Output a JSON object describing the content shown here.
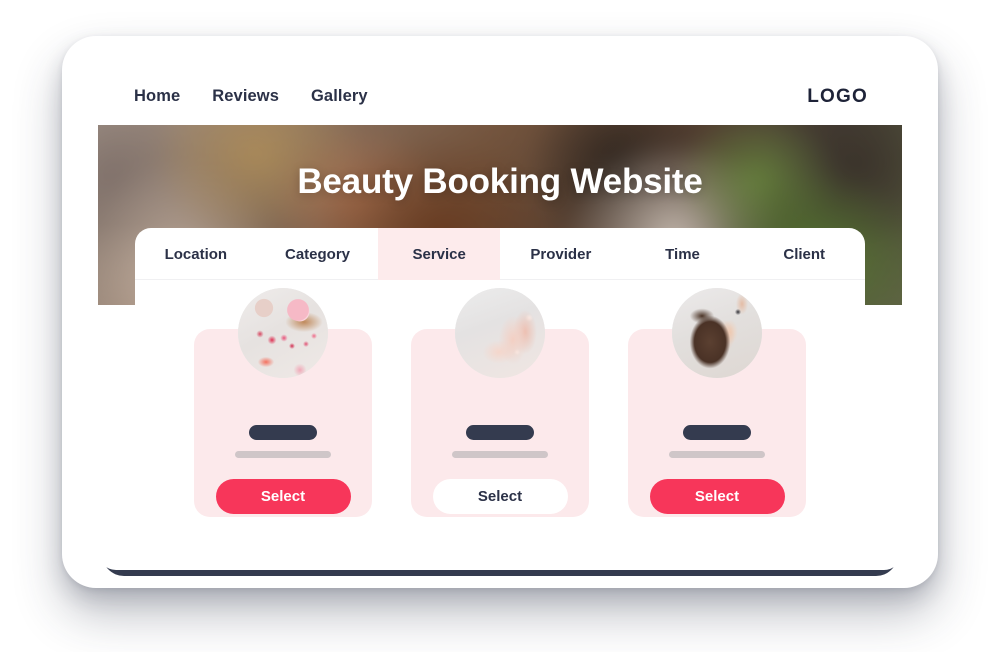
{
  "nav": {
    "links": [
      {
        "label": "Home"
      },
      {
        "label": "Reviews"
      },
      {
        "label": "Gallery"
      }
    ],
    "logo": "LOGO"
  },
  "hero": {
    "title": "Beauty Booking Website"
  },
  "booking": {
    "tabs": [
      {
        "label": "Location",
        "active": false
      },
      {
        "label": "Category",
        "active": false
      },
      {
        "label": "Service",
        "active": true
      },
      {
        "label": "Provider",
        "active": false
      },
      {
        "label": "Time",
        "active": false
      },
      {
        "label": "Client",
        "active": false
      }
    ],
    "cards": [
      {
        "image": "spa-flatlay-image",
        "select_label": "Select",
        "selected": true
      },
      {
        "image": "manicure-hands-image",
        "select_label": "Select",
        "selected": false
      },
      {
        "image": "brow-makeup-image",
        "select_label": "Select",
        "selected": true
      }
    ]
  },
  "colors": {
    "accent_red": "#f7365a",
    "card_pink": "#fce9eb",
    "active_tab_pink": "#fdebec",
    "dark_navy": "#2b3147",
    "device_base": "#343b4f",
    "placeholder_gray": "#cfc6c8"
  }
}
